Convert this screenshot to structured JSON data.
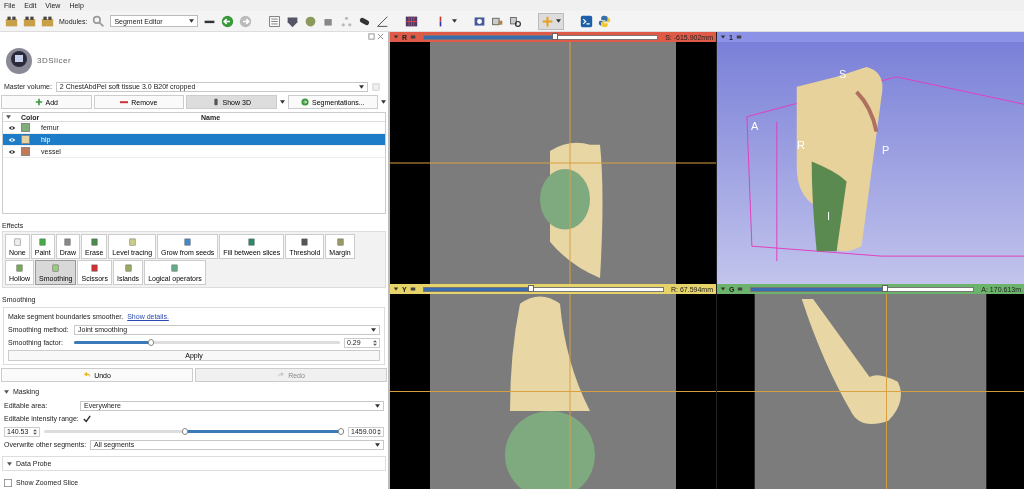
{
  "menu": [
    {
      "label": "File"
    },
    {
      "label": "Edit"
    },
    {
      "label": "View"
    },
    {
      "label": "Help"
    }
  ],
  "toolbar": {
    "modules_label": "Modules:",
    "module": "Segment Editor"
  },
  "panel": {
    "logo_text": "3DSlicer",
    "master_volume": {
      "label": "Master volume:",
      "value": "2 ChestAbdPel soft tissue 3.0 B20f cropped"
    },
    "segment_buttons": [
      {
        "label": "Add",
        "kind": "add"
      },
      {
        "label": "Remove",
        "kind": "remove"
      },
      {
        "label": "Show 3D",
        "kind": "show3d"
      },
      {
        "label": "Segmentations...",
        "kind": "segmentations"
      }
    ],
    "segments_table": {
      "columns": [
        "Color",
        "Name"
      ],
      "rows": [
        {
          "name": "femur",
          "color": "#7fae7a",
          "visible": true,
          "selected": false
        },
        {
          "name": "hip",
          "color": "#e4d2a0",
          "visible": true,
          "selected": true
        },
        {
          "name": "vessel",
          "color": "#c07a5a",
          "visible": true,
          "selected": false
        }
      ]
    },
    "effects_label": "Effects",
    "effects": [
      {
        "label": "None",
        "selected": false
      },
      {
        "label": "Paint",
        "selected": false
      },
      {
        "label": "Draw",
        "selected": false
      },
      {
        "label": "Erase",
        "selected": false
      },
      {
        "label": "Level tracing",
        "selected": false
      },
      {
        "label": "Grow from seeds",
        "selected": false
      },
      {
        "label": "Fill between slices",
        "selected": false
      },
      {
        "label": "Threshold",
        "selected": false
      },
      {
        "label": "Margin",
        "selected": false
      },
      {
        "label": "Hollow",
        "selected": false
      },
      {
        "label": "Smoothing",
        "selected": true
      },
      {
        "label": "Scissors",
        "selected": false
      },
      {
        "label": "Islands",
        "selected": false
      },
      {
        "label": "Logical operators",
        "selected": false
      }
    ],
    "smoothing": {
      "title": "Smoothing",
      "description": "Make segment boundaries smoother.",
      "link": "Show details.",
      "method_label": "Smoothing method:",
      "method": "Joint smoothing",
      "factor_label": "Smoothing factor:",
      "factor": {
        "level": 0.29
      },
      "factor_value": "0.29",
      "apply": "Apply"
    },
    "undo": {
      "label": "Undo",
      "disabled": false
    },
    "redo": {
      "label": "Redo",
      "disabled": true
    },
    "masking": {
      "title": "Masking",
      "area_label": "Editable area:",
      "area": "Everywhere",
      "range_label": "Editable intensity range:",
      "range_checked": true,
      "intensity_min": "140.53",
      "intensity_max": "1459.00",
      "range_low": {
        "level": 0.47
      },
      "range_high": {
        "level": 1.0
      },
      "overwrite_label": "Overwrite other segments:",
      "overwrite": "All segments"
    },
    "data_probe": {
      "title": "Data Probe",
      "show_zoomed_slice": {
        "label": "Show Zoomed Slice",
        "checked": false
      }
    }
  },
  "views": [
    {
      "kind": "slice",
      "label": "R",
      "color": "#e05a48",
      "level": 0.56,
      "reading": "S: -615.902mm"
    },
    {
      "kind": "render",
      "label": "1",
      "color": "#8c92e6",
      "orientation_labels": [
        "S",
        "A",
        "R",
        "P",
        "I"
      ]
    },
    {
      "kind": "slice",
      "label": "Y",
      "color": "#e6d36a",
      "level": 0.45,
      "reading": "R: 67.594mm"
    },
    {
      "kind": "slice",
      "label": "G",
      "color": "#6cb46c",
      "level": 0.6,
      "reading": "A: 170.613m"
    }
  ]
}
